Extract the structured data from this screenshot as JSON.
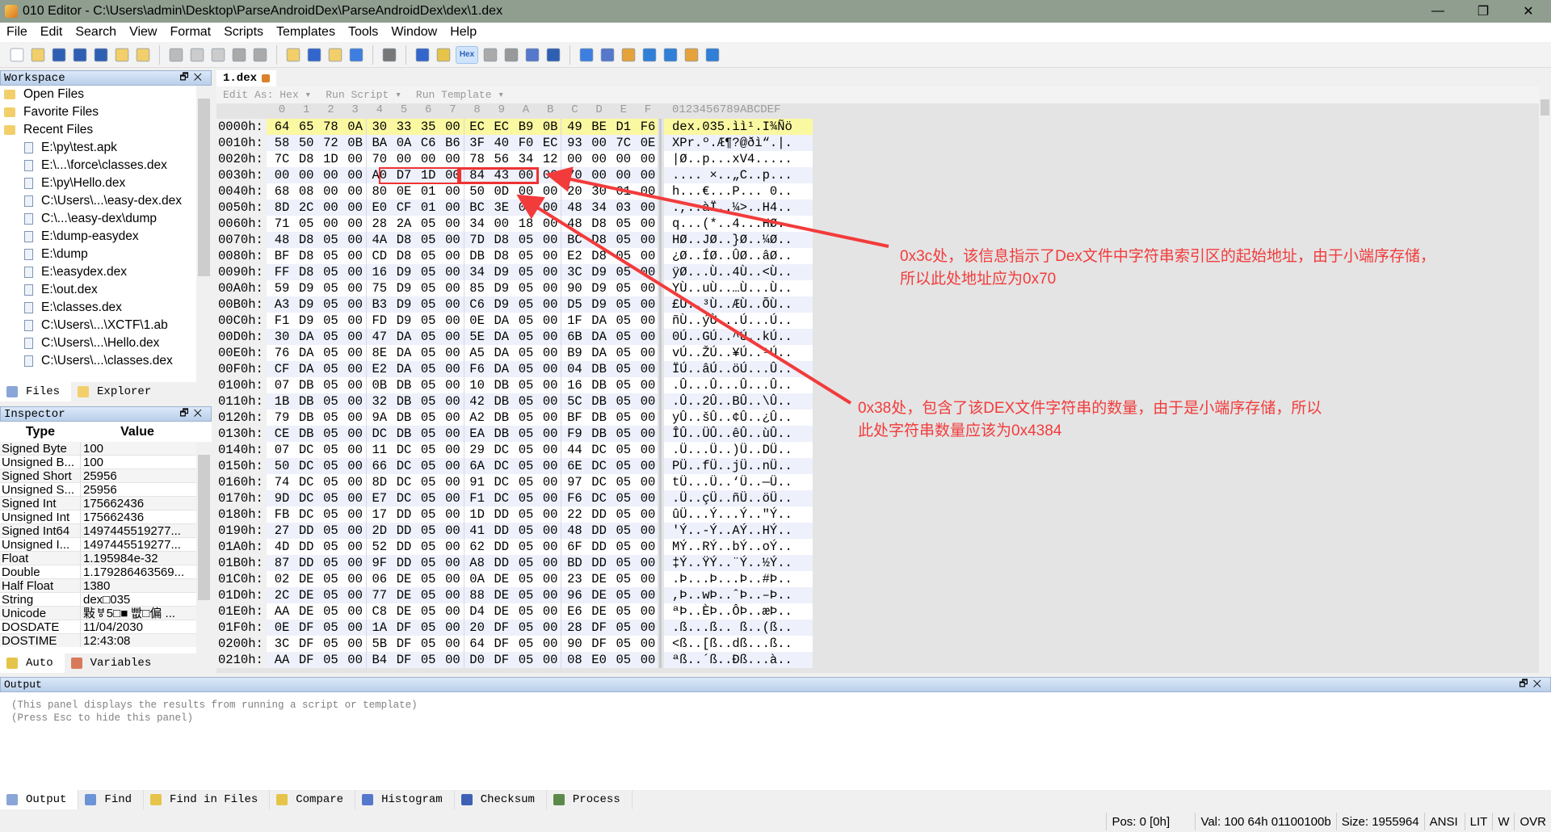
{
  "window": {
    "title": "010 Editor - C:\\Users\\admin\\Desktop\\ParseAndroidDex\\ParseAndroidDex\\dex\\1.dex",
    "min": "—",
    "max": "❐",
    "close": "✕"
  },
  "menu": [
    "File",
    "Edit",
    "Search",
    "View",
    "Format",
    "Scripts",
    "Templates",
    "Tools",
    "Window",
    "Help"
  ],
  "toolbar": {
    "hex_label": "Hex",
    "icons": [
      "new-file-icon",
      "open-file-icon",
      "save-icon",
      "save-as-icon",
      "save-all-icon",
      "open-folder-icon",
      "close-icon",
      "cut-icon",
      "copy-icon",
      "paste-icon",
      "undo-icon",
      "redo-icon",
      "find-icon",
      "replace-icon",
      "find-in-files-icon",
      "goto-icon",
      "print-icon",
      "font-icon",
      "highlight-icon",
      "hex-mode-icon",
      "word-wrap-icon",
      "pilcrow-icon",
      "columns-icon",
      "binary-icon",
      "calculator-icon",
      "template-icon",
      "compare-icon",
      "percent-icon",
      "histogram-icon",
      "checksum-icon",
      "base-converter-icon"
    ]
  },
  "workspace": {
    "title": "Workspace",
    "groups": [
      "Open Files",
      "Favorite Files",
      "Recent Files"
    ],
    "recent": [
      "E:\\py\\test.apk",
      "E:\\...\\force\\classes.dex",
      "E:\\py\\Hello.dex",
      "C:\\Users\\...\\easy-dex.dex",
      "C:\\...\\easy-dex\\dump",
      "E:\\dump-easydex",
      "E:\\dump",
      "E:\\easydex.dex",
      "E:\\out.dex",
      "E:\\classes.dex",
      "C:\\Users\\...\\XCTF\\1.ab",
      "C:\\Users\\...\\Hello.dex",
      "C:\\Users\\...\\classes.dex"
    ],
    "tabs": [
      "Files",
      "Explorer"
    ]
  },
  "inspector": {
    "title": "Inspector",
    "col_type": "Type",
    "col_value": "Value",
    "rows": [
      [
        "Signed Byte",
        "100"
      ],
      [
        "Unsigned B...",
        "100"
      ],
      [
        "Signed Short",
        "25956"
      ],
      [
        "Unsigned S...",
        "25956"
      ],
      [
        "Signed Int",
        "175662436"
      ],
      [
        "Unsigned Int",
        "175662436"
      ],
      [
        "Signed Int64",
        "1497445519277..."
      ],
      [
        "Unsigned I...",
        "1497445519277..."
      ],
      [
        "Float",
        "1.195984e-32"
      ],
      [
        "Double",
        "1.179286463569..."
      ],
      [
        "Half Float",
        "1380"
      ],
      [
        "String",
        "dex□035"
      ],
      [
        "Unicode",
        "敤ㅸ5□■ 빲□偏 ..."
      ],
      [
        "DOSDATE",
        "11/04/2030"
      ],
      [
        "DOSTIME",
        "12:43:08"
      ]
    ],
    "tabs": [
      "Auto",
      "Variables"
    ]
  },
  "editor": {
    "tab": "1.dex",
    "edit_as": "Edit As: Hex ▾",
    "run_script": "Run Script ▾",
    "run_template": "Run Template ▾",
    "col_header": [
      "0",
      "1",
      "2",
      "3",
      "4",
      "5",
      "6",
      "7",
      "8",
      "9",
      "A",
      "B",
      "C",
      "D",
      "E",
      "F"
    ],
    "ascii_header": "0123456789ABCDEF",
    "selected_row": 0,
    "rows": [
      [
        "0000h:",
        "64 65 78 0A 30 33 35 00 EC EC B9 0B 49 BE D1 F6",
        "dex.035.ìì¹.I¾Ñö"
      ],
      [
        "0010h:",
        "58 50 72 0B BA 0A C6 B6 3F 40 F0 EC 93 00 7C 0E",
        "XPr.º.Æ¶?@ðì“.|."
      ],
      [
        "0020h:",
        "7C D8 1D 00 70 00 00 00 78 56 34 12 00 00 00 00",
        "|Ø..p...xV4....."
      ],
      [
        "0030h:",
        "00 00 00 00 A0 D7 1D 00 84 43 00 00 70 00 00 00",
        ".... ×..„C..p..."
      ],
      [
        "0040h:",
        "68 08 00 00 80 0E 01 00 50 0D 00 00 20 30 01 00",
        "h...€...P... 0.."
      ],
      [
        "0050h:",
        "8D 2C 00 00 E0 CF 01 00 BC 3E 00 00 48 34 03 00",
        ".,..àÏ..¼>..H4.."
      ],
      [
        "0060h:",
        "71 05 00 00 28 2A 05 00 34 00 18 00 48 D8 05 00",
        "q...(*..4...HØ.."
      ],
      [
        "0070h:",
        "48 D8 05 00 4A D8 05 00 7D D8 05 00 BC D8 05 00",
        "HØ..JØ..}Ø..¼Ø.."
      ],
      [
        "0080h:",
        "BF D8 05 00 CD D8 05 00 DB D8 05 00 E2 D8 05 00",
        "¿Ø..ÍØ..ÛØ..âØ.."
      ],
      [
        "0090h:",
        "FF D8 05 00 16 D9 05 00 34 D9 05 00 3C D9 05 00",
        "ÿØ...Ù..4Ù..<Ù.."
      ],
      [
        "00A0h:",
        "59 D9 05 00 75 D9 05 00 85 D9 05 00 90 D9 05 00",
        "YÙ..uÙ..…Ù...Ù.."
      ],
      [
        "00B0h:",
        "A3 D9 05 00 B3 D9 05 00 C6 D9 05 00 D5 D9 05 00",
        "£Ù..³Ù..ÆÙ..ÕÙ.."
      ],
      [
        "00C0h:",
        "F1 D9 05 00 FD D9 05 00 0E DA 05 00 1F DA 05 00",
        "ñÙ..ýÙ...Ú...Ú.."
      ],
      [
        "00D0h:",
        "30 DA 05 00 47 DA 05 00 5E DA 05 00 6B DA 05 00",
        "0Ú..GÚ..^Ú..kÚ.."
      ],
      [
        "00E0h:",
        "76 DA 05 00 8E DA 05 00 A5 DA 05 00 B9 DA 05 00",
        "vÚ..ŽÚ..¥Ú..¹Ú.."
      ],
      [
        "00F0h:",
        "CF DA 05 00 E2 DA 05 00 F6 DA 05 00 04 DB 05 00",
        "ÏÚ..âÚ..öÚ...Û.."
      ],
      [
        "0100h:",
        "07 DB 05 00 0B DB 05 00 10 DB 05 00 16 DB 05 00",
        ".Û...Û...Û...Û.."
      ],
      [
        "0110h:",
        "1B DB 05 00 32 DB 05 00 42 DB 05 00 5C DB 05 00",
        ".Û..2Û..BÛ..\\Û.."
      ],
      [
        "0120h:",
        "79 DB 05 00 9A DB 05 00 A2 DB 05 00 BF DB 05 00",
        "yÛ..šÛ..¢Û..¿Û.."
      ],
      [
        "0130h:",
        "CE DB 05 00 DC DB 05 00 EA DB 05 00 F9 DB 05 00",
        "ÎÛ..ÜÛ..êÛ..ùÛ.."
      ],
      [
        "0140h:",
        "07 DC 05 00 11 DC 05 00 29 DC 05 00 44 DC 05 00",
        ".Ü...Ü..)Ü..DÜ.."
      ],
      [
        "0150h:",
        "50 DC 05 00 66 DC 05 00 6A DC 05 00 6E DC 05 00",
        "PÜ..fÜ..jÜ..nÜ.."
      ],
      [
        "0160h:",
        "74 DC 05 00 8D DC 05 00 91 DC 05 00 97 DC 05 00",
        "tÜ...Ü..‘Ü..—Ü.."
      ],
      [
        "0170h:",
        "9D DC 05 00 E7 DC 05 00 F1 DC 05 00 F6 DC 05 00",
        ".Ü..çÜ..ñÜ..öÜ.."
      ],
      [
        "0180h:",
        "FB DC 05 00 17 DD 05 00 1D DD 05 00 22 DD 05 00",
        "ûÜ...Ý...Ý..\"Ý.."
      ],
      [
        "0190h:",
        "27 DD 05 00 2D DD 05 00 41 DD 05 00 48 DD 05 00",
        "'Ý..-Ý..AÝ..HÝ.."
      ],
      [
        "01A0h:",
        "4D DD 05 00 52 DD 05 00 62 DD 05 00 6F DD 05 00",
        "MÝ..RÝ..bÝ..oÝ.."
      ],
      [
        "01B0h:",
        "87 DD 05 00 9F DD 05 00 A8 DD 05 00 BD DD 05 00",
        "‡Ý..ŸÝ..¨Ý..½Ý.."
      ],
      [
        "01C0h:",
        "02 DE 05 00 06 DE 05 00 0A DE 05 00 23 DE 05 00",
        ".Þ...Þ...Þ..#Þ.."
      ],
      [
        "01D0h:",
        "2C DE 05 00 77 DE 05 00 88 DE 05 00 96 DE 05 00",
        ",Þ..wÞ..ˆÞ..–Þ.."
      ],
      [
        "01E0h:",
        "AA DE 05 00 C8 DE 05 00 D4 DE 05 00 E6 DE 05 00",
        "ªÞ..ÈÞ..ÔÞ..æÞ.."
      ],
      [
        "01F0h:",
        "0E DF 05 00 1A DF 05 00 20 DF 05 00 28 DF 05 00",
        ".ß...ß.. ß..(ß.."
      ],
      [
        "0200h:",
        "3C DF 05 00 5B DF 05 00 64 DF 05 00 90 DF 05 00",
        "<ß..[ß..dß...ß.."
      ],
      [
        "0210h:",
        "AA DF 05 00 B4 DF 05 00 D0 DF 05 00 08 E0 05 00",
        "ªß..´ß..Ðß...à.."
      ]
    ]
  },
  "annotations": {
    "color": "#f23b3b",
    "string_ids_off": [
      "0x3c处，该信息指示了Dex文件中字符串索引区的起始地址，由于小端序存储，",
      "所以此处地址应为0x70"
    ],
    "string_ids_size": [
      "0x38处，包含了该DEX文件字符串的数量，由于是小端序存储，所以",
      "此处字符串数量应该为0x4384"
    ]
  },
  "output": {
    "title": "Output",
    "lines": [
      "(This panel displays the results from running a script or template)",
      "(Press Esc to hide this panel)"
    ],
    "tabs": [
      "Output",
      "Find",
      "Find in Files",
      "Compare",
      "Histogram",
      "Checksum",
      "Process"
    ]
  },
  "status": {
    "pos": "Pos: 0 [0h]",
    "val": "Val: 100 64h 01100100b",
    "size": "Size: 1955964",
    "encoding": "ANSI",
    "endian": "LIT",
    "mode_w": "W",
    "ovr": "OVR"
  }
}
